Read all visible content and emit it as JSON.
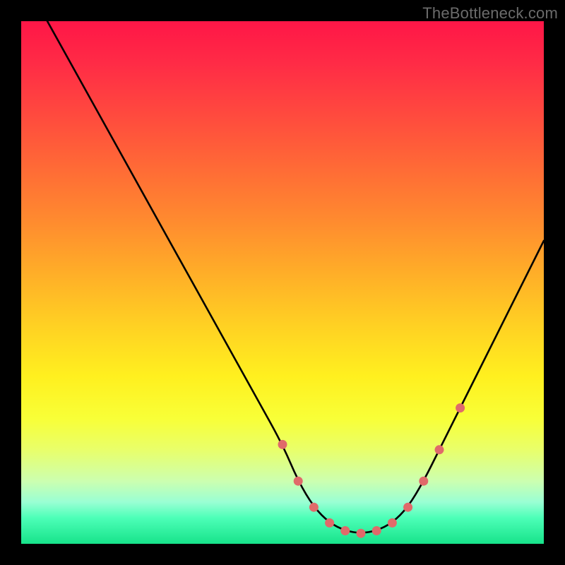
{
  "watermark": "TheBottleneck.com",
  "chart_data": {
    "type": "line",
    "title": "",
    "xlabel": "",
    "ylabel": "",
    "xlim": [
      0,
      100
    ],
    "ylim": [
      0,
      100
    ],
    "grid": false,
    "legend": false,
    "series": [
      {
        "name": "bottleneck-curve",
        "x": [
          5,
          10,
          15,
          20,
          25,
          30,
          35,
          40,
          45,
          50,
          53,
          56,
          59,
          62,
          65,
          68,
          71,
          74,
          77,
          80,
          84,
          88,
          92,
          96,
          100
        ],
        "y": [
          100,
          91,
          82,
          73,
          64,
          55,
          46,
          37,
          28,
          19,
          12,
          7,
          4,
          2.5,
          2,
          2.5,
          4,
          7,
          12,
          18,
          26,
          34,
          42,
          50,
          58
        ]
      }
    ],
    "markers": {
      "name": "highlight-points",
      "color": "#e06a6a",
      "x": [
        50,
        53,
        56,
        59,
        62,
        65,
        68,
        71,
        74,
        77,
        80,
        84
      ],
      "y": [
        19,
        12,
        7,
        4,
        2.5,
        2,
        2.5,
        4,
        7,
        12,
        18,
        26
      ]
    },
    "background_gradient_stops": [
      {
        "pos": 0.0,
        "color": "#ff1647"
      },
      {
        "pos": 0.5,
        "color": "#ffad28"
      },
      {
        "pos": 0.7,
        "color": "#fff01f"
      },
      {
        "pos": 0.9,
        "color": "#9affd4"
      },
      {
        "pos": 1.0,
        "color": "#17e38a"
      }
    ]
  }
}
